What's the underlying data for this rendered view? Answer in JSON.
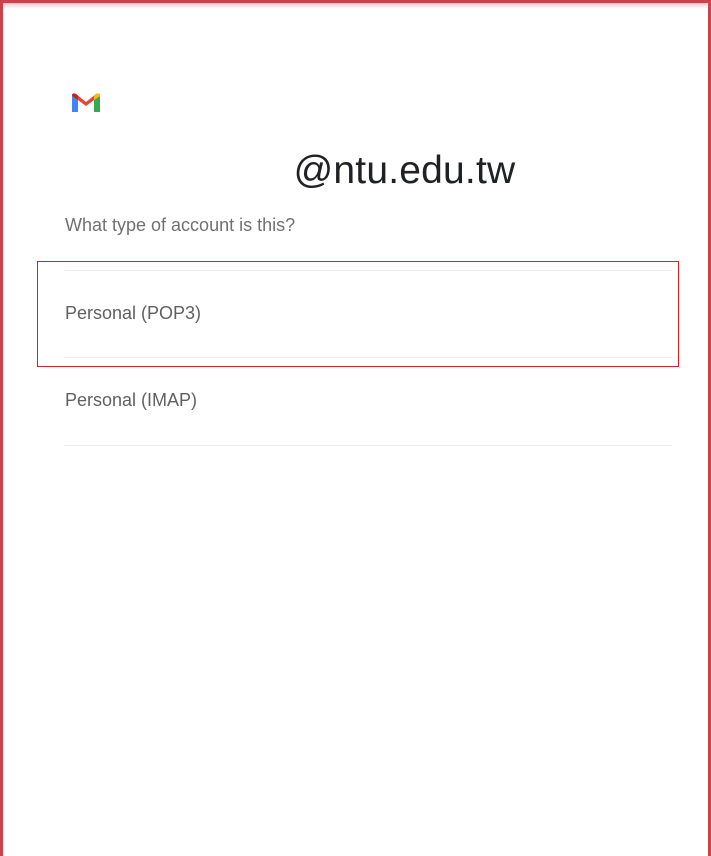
{
  "header": {
    "account_domain": "@ntu.edu.tw",
    "logo_icon": "gmail-icon"
  },
  "main": {
    "question": "What type of account is this?",
    "options": [
      {
        "label": "Personal (POP3)",
        "highlighted": true
      },
      {
        "label": "Personal (IMAP)",
        "highlighted": false
      }
    ]
  },
  "colors": {
    "frame_border": "#c8434a",
    "highlight_border": "#d81e2a",
    "gmail_blue": "#4285F4",
    "gmail_red": "#EA4335",
    "gmail_yellow": "#FBBC05",
    "gmail_green": "#34A853"
  }
}
